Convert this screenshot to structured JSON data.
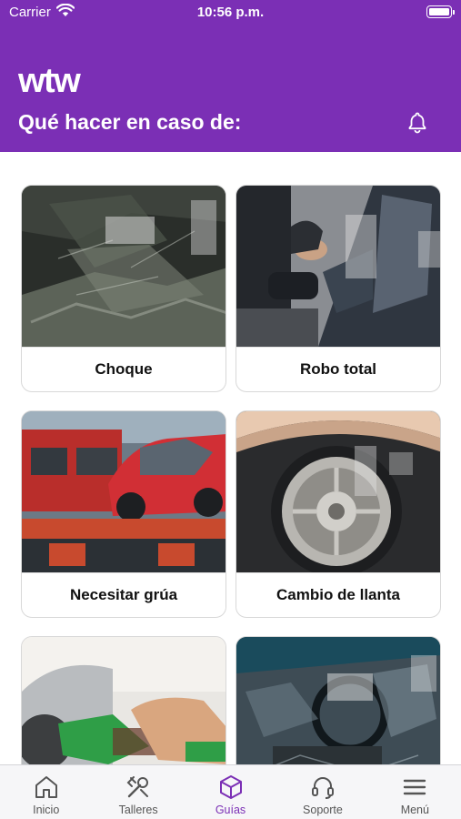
{
  "status_bar": {
    "carrier": "Carrier",
    "time": "10:56 p.m."
  },
  "header": {
    "logo": "wtw",
    "subtitle": "Qué hacer en caso de:",
    "bell_icon": "bell-icon"
  },
  "cards": [
    {
      "label": "Choque",
      "image": "crashed-car-interior-photo"
    },
    {
      "label": "Robo total",
      "image": "car-theft-photo"
    },
    {
      "label": "Necesitar grúa",
      "image": "tow-truck-photo"
    },
    {
      "label": "Cambio de llanta",
      "image": "tire-photo"
    },
    {
      "label": "",
      "image": "fuel-nozzle-photo"
    },
    {
      "label": "",
      "image": "broken-window-photo"
    }
  ],
  "tabs": [
    {
      "label": "Inicio",
      "icon": "home-icon",
      "active": false
    },
    {
      "label": "Talleres",
      "icon": "tools-icon",
      "active": false
    },
    {
      "label": "Guías",
      "icon": "box-icon",
      "active": true
    },
    {
      "label": "Soporte",
      "icon": "headset-icon",
      "active": false
    },
    {
      "label": "Menú",
      "icon": "menu-icon",
      "active": false
    }
  ],
  "colors": {
    "brand": "#7b2fb5",
    "tab_inactive": "#555555"
  }
}
